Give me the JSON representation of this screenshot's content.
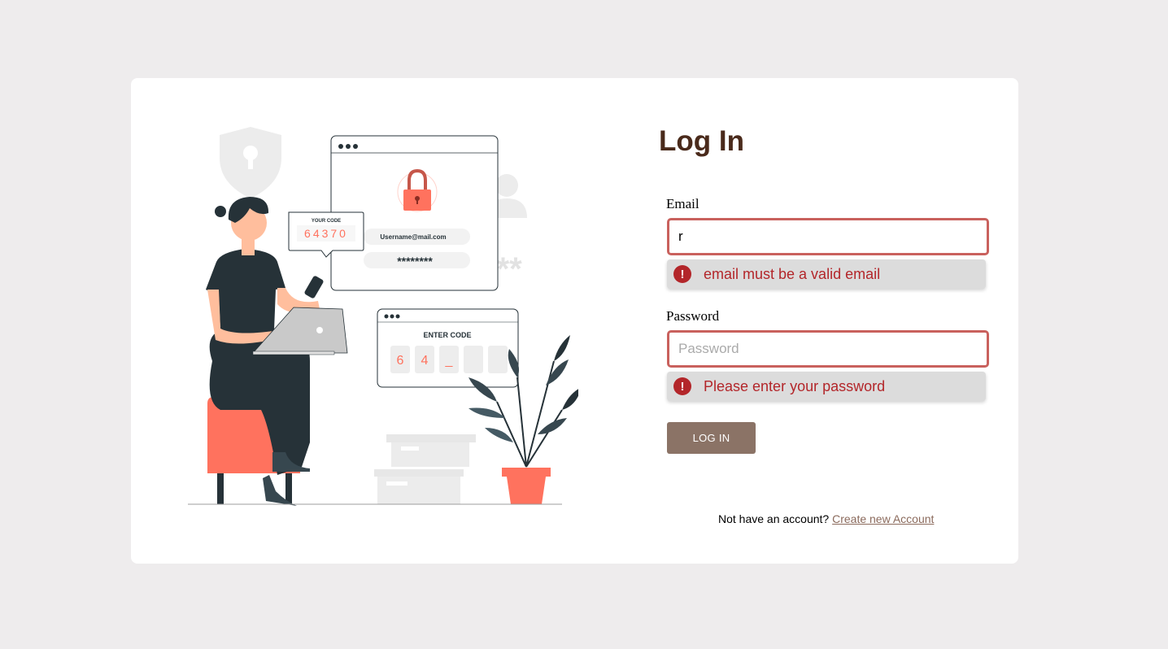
{
  "login": {
    "title": "Log In",
    "email_label": "Email",
    "email_value": "r",
    "email_error": "email must be a valid email",
    "password_label": "Password",
    "password_placeholder": "Password",
    "password_error": "Please enter your password",
    "submit_label": "LOG IN",
    "signup_prompt": "Not have an account?",
    "signup_link": "Create new Account"
  },
  "illustration": {
    "your_code_title": "YOUR CODE",
    "your_code_value": "64370",
    "username_text": "Username@mail.com",
    "password_mask": "********",
    "stars_text": "***",
    "enter_code_title": "ENTER CODE",
    "code_digit_1": "6",
    "code_digit_2": "4",
    "code_digit_3": "_"
  },
  "colors": {
    "accent": "#ff725e",
    "brand_brown": "#8b7366",
    "title_brown": "#4a2a1b",
    "error_red": "#b3262a",
    "input_border": "#c9615d"
  }
}
